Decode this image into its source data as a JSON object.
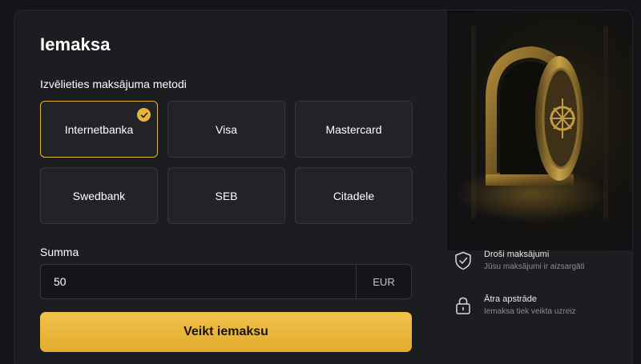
{
  "modal": {
    "title": "Iemaksa",
    "method_label": "Izvēlieties maksājuma metodi",
    "methods": [
      {
        "label": "Internetbanka",
        "selected": true
      },
      {
        "label": "Visa",
        "selected": false
      },
      {
        "label": "Mastercard",
        "selected": false
      },
      {
        "label": "Swedbank",
        "selected": false
      },
      {
        "label": "SEB",
        "selected": false
      },
      {
        "label": "Citadele",
        "selected": false
      }
    ],
    "amount_label": "Summa",
    "amount_value": "50",
    "currency": "EUR",
    "pay_button_label": "Veikt iemaksu"
  },
  "features": [
    {
      "icon": "shield-check-icon",
      "title": "Droši maksājumi",
      "subtitle": "Jūsu maksājumi ir aizsargāti"
    },
    {
      "icon": "lock-icon",
      "title": "Ātra apstrāde",
      "subtitle": "Iemaksa tiek veikta uzreiz"
    }
  ],
  "colors": {
    "accent": "#e7b53a",
    "background": "#1c1d21",
    "card": "#222327"
  }
}
